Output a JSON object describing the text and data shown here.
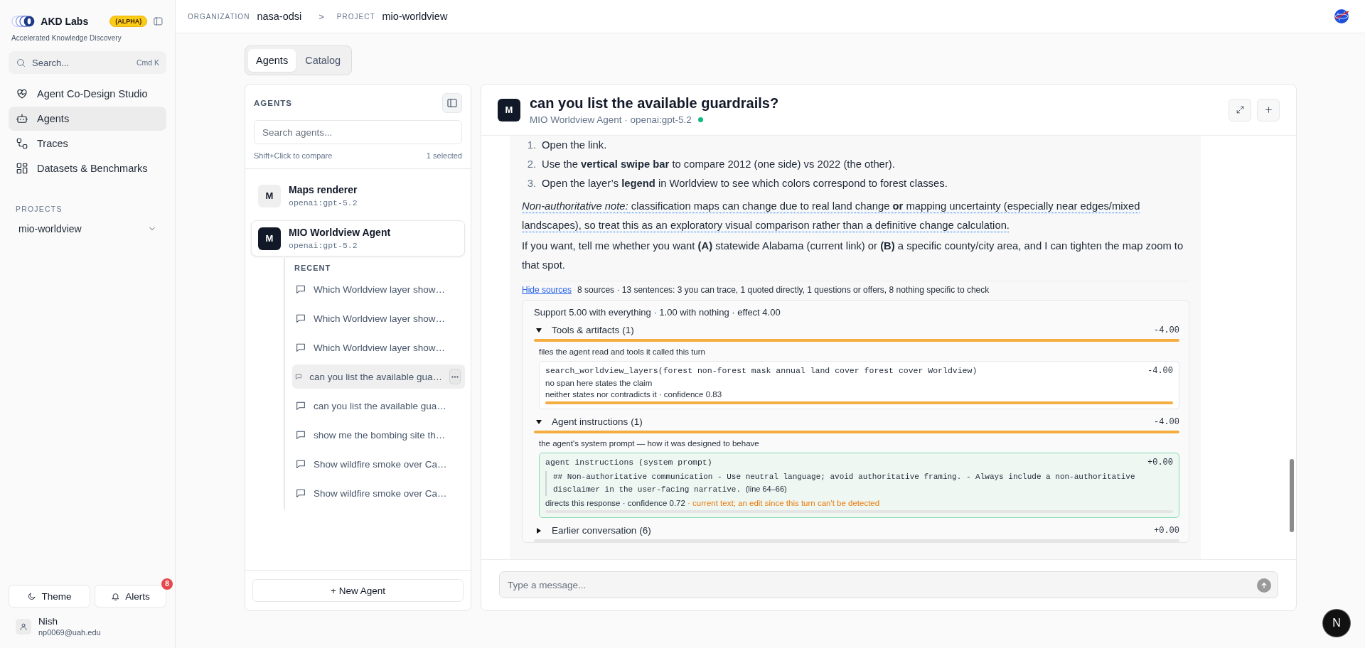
{
  "brand": {
    "name": "AKD Labs",
    "badge": "(ALPHA)",
    "tagline": "Accelerated Knowledge Discovery"
  },
  "search": {
    "placeholder": "Search...",
    "shortcut": "Cmd K"
  },
  "nav": [
    {
      "kind": "studio",
      "label": "Agent Co-Design Studio",
      "selected": false
    },
    {
      "kind": "agents",
      "label": "Agents",
      "selected": true
    },
    {
      "kind": "traces",
      "label": "Traces",
      "selected": false
    },
    {
      "kind": "datasets",
      "label": "Datasets & Benchmarks",
      "selected": false
    }
  ],
  "projects": {
    "heading": "PROJECTS",
    "items": [
      {
        "label": "mio-worldview"
      }
    ]
  },
  "footer": {
    "theme": "Theme",
    "alerts": "Alerts",
    "alerts_count": "8",
    "user": {
      "name": "Nish",
      "email": "np0069@uah.edu"
    }
  },
  "breadcrumb": {
    "separator": ">",
    "parts": [
      {
        "label": "ORGANIZATION",
        "value": "nasa-odsi"
      },
      {
        "label": "PROJECT",
        "value": "mio-worldview"
      }
    ]
  },
  "view_tabs": [
    {
      "label": "Agents",
      "selected": true
    },
    {
      "label": "Catalog",
      "selected": false
    }
  ],
  "agents_panel": {
    "heading": "AGENTS",
    "search_placeholder": "Search agents...",
    "hint": "Shift+Click to compare",
    "selection": "1 selected",
    "agents": [
      {
        "initial": "M",
        "name": "Maps renderer",
        "model": "openai:gpt-5.2",
        "selected": false
      },
      {
        "initial": "M",
        "name": "MIO Worldview Agent",
        "model": "openai:gpt-5.2",
        "selected": true,
        "recent_heading": "RECENT",
        "recent": [
          {
            "label": "Which Worldview layer show…",
            "selected": false
          },
          {
            "label": "Which Worldview layer show…",
            "selected": false
          },
          {
            "label": "Which Worldview layer show…",
            "selected": false
          },
          {
            "label": "can you list the available gua…",
            "selected": true
          },
          {
            "label": "can you list the available gua…",
            "selected": false
          },
          {
            "label": "show me the bombing site th…",
            "selected": false
          },
          {
            "label": "Show wildfire smoke over Ca…",
            "selected": false
          },
          {
            "label": "Show wildfire smoke over Ca…",
            "selected": false
          }
        ]
      }
    ],
    "new_button": "+ New Agent"
  },
  "chat": {
    "avatar": "M",
    "title": "can you list the available guardrails?",
    "subtitle": "MIO Worldview Agent · openai:gpt-5.2",
    "online": true,
    "message": {
      "steps": [
        {
          "number": "1.",
          "text": "Open the link."
        },
        {
          "number": "2.",
          "text": "Use the **vertical swipe bar** to compare 2012 (one side) vs 2022 (the other)."
        },
        {
          "number": "3.",
          "text": "Open the layer’s **legend** in Worldview to see which colors correspond to forest classes."
        }
      ],
      "note": "*Non-authoritative note:* classification maps can change due to real land change **or** mapping uncertainty (especially near edges/mixed landscapes), so treat this as an exploratory visual comparison rather than a definitive change calculation.",
      "followup": "If you want, tell me whether you want **(A)** statewide Alabama (current link) or **(B)** a specific county/city area, and I can tighten the map zoom to that spot."
    },
    "sources": {
      "toggle": "Hide sources",
      "summary": "8 sources · 13 sentences: 3 you can trace, 1 quoted directly, 1 questions or offers, 8 nothing specific to check",
      "support": "Support 5.00 with everything · 1.00 with nothing · effect 4.00",
      "groups": [
        {
          "title": "Tools & artifacts",
          "count": "(1)",
          "score": "-4.00",
          "expanded": true,
          "color": "#f6ad3f",
          "description": "files the agent read and tools it called this turn",
          "items": [
            {
              "kind": "tool",
              "color": "#f6ad3f",
              "signature": "search_worldview_layers(forest non-forest mask annual land cover forest cover Worldview)",
              "score": "-4.00",
              "lines": [
                "no span here states the claim",
                "neither states nor contradicts it · confidence 0.83"
              ]
            }
          ]
        },
        {
          "title": "Agent instructions",
          "count": "(1)",
          "score": "-4.00",
          "expanded": true,
          "color": "#f6ad3f",
          "description": "the agent's system prompt — how it was designed to behave",
          "items": [
            {
              "kind": "instructions",
              "color": "#e5e5e5",
              "signature": "agent instructions (system prompt)",
              "score": "+0.00",
              "quote": "## Non-authoritative communication - Use neutral language; avoid authoritative framing. - Always include a non-authoritative disclaimer in the user-facing narrative.",
              "line_ref": "(line 64–66)",
              "footer": "directs this response · confidence 0.72",
              "warning": "· current text; an edit since this turn can't be detected"
            }
          ]
        },
        {
          "title": "Earlier conversation",
          "count": "(6)",
          "score": "+0.00",
          "expanded": false,
          "color": "#e5e5e5"
        }
      ]
    },
    "input_placeholder": "Type a message..."
  },
  "dev_badge": "N"
}
